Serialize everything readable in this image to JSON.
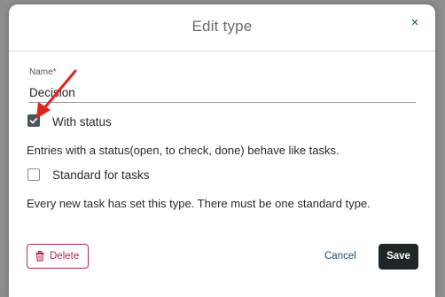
{
  "dialog": {
    "title": "Edit type",
    "close_glyph": "×"
  },
  "name_field": {
    "label": "Name",
    "required_mark": "*",
    "value": "Decision"
  },
  "with_status": {
    "checked": true,
    "label": "With status",
    "description": "Entries with a status(open, to check, done) behave like tasks."
  },
  "standard_for_tasks": {
    "checked": false,
    "label": "Standard for tasks",
    "description": "Every new task has set this type. There must be one standard type."
  },
  "footer": {
    "delete_label": "Delete",
    "cancel_label": "Cancel",
    "save_label": "Save"
  },
  "colors": {
    "accent_danger": "#b7234d",
    "primary_button": "#1f2528",
    "annotation_arrow": "#e0231f"
  },
  "icons": {
    "close": "close-icon",
    "checkmark": "check-icon",
    "delete": "trash-icon",
    "annotation": "arrow-annotation"
  }
}
